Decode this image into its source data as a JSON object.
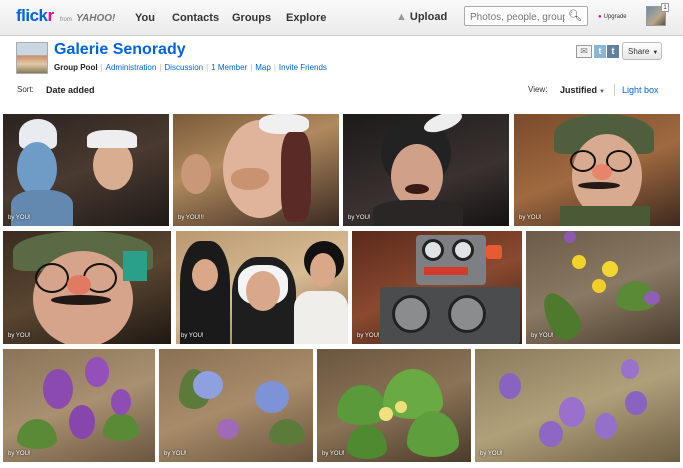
{
  "topbar": {
    "logo": {
      "flick": "flick",
      "r": "r",
      "from": "from",
      "yahoo": "YAHOO!"
    },
    "nav": [
      "You",
      "Contacts",
      "Groups",
      "Explore"
    ],
    "upload": "Upload",
    "search_placeholder": "Photos, people, groups",
    "upgrade": "Upgrade",
    "notification_count": "1"
  },
  "group": {
    "title": "Galerie Senorady",
    "tabs": [
      {
        "label": "Group Pool",
        "current": true
      },
      {
        "label": "Administration"
      },
      {
        "label": "Discussion"
      },
      {
        "label": "1 Member"
      },
      {
        "label": "Map"
      },
      {
        "label": "Invite Friends"
      }
    ],
    "share_label": "Share"
  },
  "sortbar": {
    "sort_label": "Sort:",
    "sort_value": "Date added",
    "view_label": "View:",
    "view_value": "Justified",
    "lightbox": "Light box"
  },
  "photos": [
    {
      "subject": "smurf-costumes",
      "credit": "by YOU!"
    },
    {
      "subject": "nose-mask-woman",
      "credit": "by YOU!!!"
    },
    {
      "subject": "bunny-mask",
      "credit": "by YOU!"
    },
    {
      "subject": "glasses-nose-man",
      "credit": "by YOU!"
    },
    {
      "subject": "glasses-nose-closeup",
      "credit": "by YOU!"
    },
    {
      "subject": "nuns",
      "credit": "by YOU!"
    },
    {
      "subject": "robot-costume",
      "credit": "by YOU!"
    },
    {
      "subject": "yellow-flowers",
      "credit": "by YOU!"
    },
    {
      "subject": "purple-flowers",
      "credit": "by YOU!"
    },
    {
      "subject": "blue-flowers",
      "credit": "by YOU!"
    },
    {
      "subject": "primrose",
      "credit": "by YOU!"
    },
    {
      "subject": "crocus-field",
      "credit": "by YOU!"
    }
  ],
  "colors": {
    "link": "#0063dc",
    "accent": "#ff0084"
  }
}
